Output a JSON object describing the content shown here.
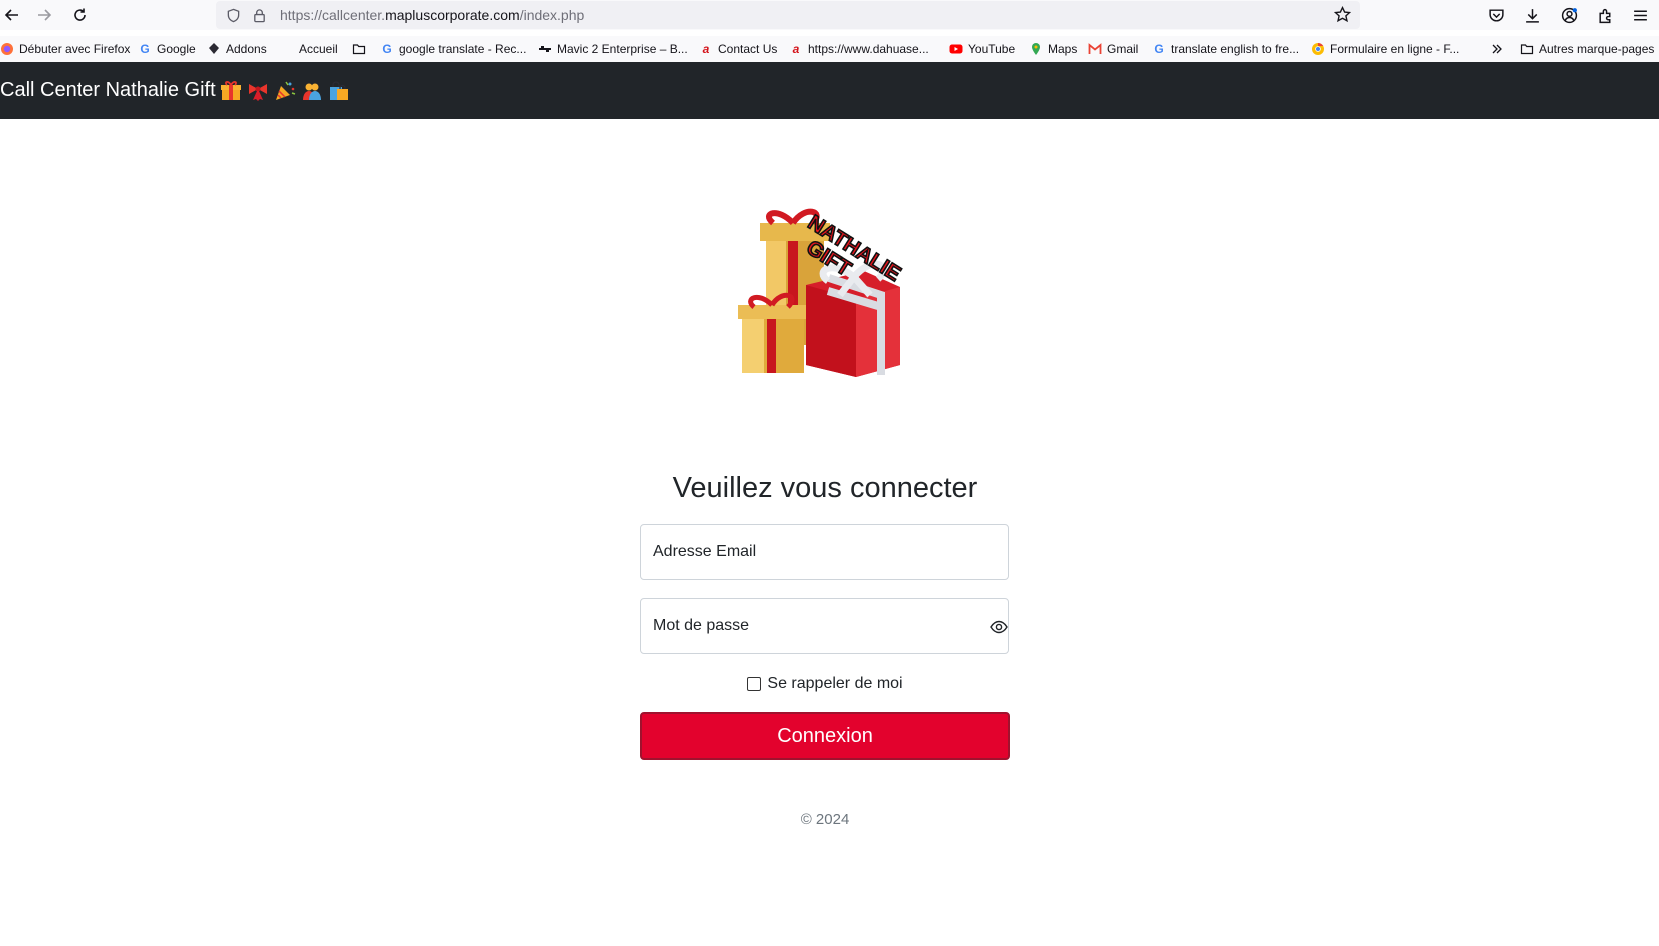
{
  "browser": {
    "url_prefix": "https://callcenter.",
    "url_domain": "mapluscorporate.com",
    "url_path": "/index.php"
  },
  "bookmarks": [
    {
      "label": "Débuter avec Firefox",
      "icon": "firefox-icon"
    },
    {
      "label": "Google",
      "icon": "google-icon"
    },
    {
      "label": "Addons",
      "icon": "addons-icon"
    },
    {
      "label": "Accueil",
      "icon": ""
    },
    {
      "label": "",
      "icon": "folder-icon"
    },
    {
      "label": "google translate - Rec...",
      "icon": "google-icon"
    },
    {
      "label": "Mavic 2 Enterprise – B...",
      "icon": "dji-icon"
    },
    {
      "label": "Contact Us",
      "icon": "dahua-icon"
    },
    {
      "label": "https://www.dahuase...",
      "icon": "dahua-icon"
    },
    {
      "label": "YouTube",
      "icon": "youtube-icon"
    },
    {
      "label": "Maps",
      "icon": "maps-icon"
    },
    {
      "label": "Gmail",
      "icon": "gmail-icon"
    },
    {
      "label": "translate english to fre...",
      "icon": "google-icon"
    },
    {
      "label": "Formulaire en ligne - F...",
      "icon": "chrome-icon"
    }
  ],
  "other_bookmarks": "Autres marque-pages",
  "navbar": {
    "brand": "Call Center Nathalie Gift"
  },
  "logo": {
    "text_line1": "NATHALIE",
    "text_line2": "GIFT"
  },
  "login": {
    "heading": "Veuillez vous connecter",
    "email_placeholder": "Adresse Email",
    "password_placeholder": "Mot de passe",
    "remember_label": "Se rappeler de moi",
    "submit_label": "Connexion"
  },
  "footer": {
    "copyright": "© 2024"
  },
  "colors": {
    "navbar_bg": "#212529",
    "button_bg": "#e3022d",
    "button_border": "#a0122e"
  }
}
